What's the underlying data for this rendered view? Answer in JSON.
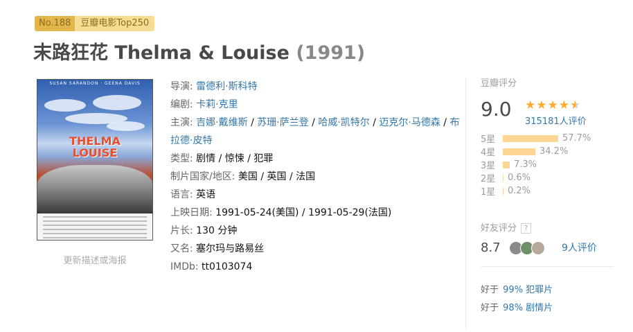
{
  "top250": {
    "rank": "No.188",
    "label": "豆瓣电影Top250"
  },
  "movie": {
    "title": "末路狂花 Thelma & Louise",
    "year": "(1991)"
  },
  "poster": {
    "cast_line": "SUSAN SARANDON · GEENA DAVIS",
    "title_line1": "THELMA",
    "title_line2": "LOUISE",
    "update_link": "更新描述或海报"
  },
  "info": {
    "director_label": "导演:",
    "director": "雷德利·斯科特",
    "writer_label": "编剧:",
    "writer": "卡莉·克里",
    "cast_label": "主演:",
    "cast": [
      "吉娜·戴维斯",
      "苏珊·萨兰登",
      "哈威·凯特尔",
      "迈克尔·马德森",
      "布拉德·皮特"
    ],
    "genre_label": "类型:",
    "genres": [
      "剧情",
      "惊悚",
      "犯罪"
    ],
    "country_label": "制片国家/地区:",
    "country": "美国 / 英国 / 法国",
    "language_label": "语言:",
    "language": "英语",
    "release_label": "上映日期:",
    "release_dates": [
      "1991-05-24(美国)",
      "1991-05-29(法国)"
    ],
    "runtime_label": "片长:",
    "runtime": "130 分钟",
    "aka_label": "又名:",
    "aka": "塞尔玛与路易丝",
    "imdb_label": "IMDb:",
    "imdb": "tt0103074"
  },
  "rating": {
    "title": "豆瓣评分",
    "score": "9.0",
    "stars_value": 4.5,
    "votes": "315181人评价",
    "distribution": [
      {
        "label": "5星",
        "percent": "57.7%",
        "value": 57.7
      },
      {
        "label": "4星",
        "percent": "34.2%",
        "value": 34.2
      },
      {
        "label": "3星",
        "percent": "7.3%",
        "value": 7.3
      },
      {
        "label": "2星",
        "percent": "0.6%",
        "value": 0.6
      },
      {
        "label": "1星",
        "percent": "0.2%",
        "value": 0.2
      }
    ]
  },
  "friends": {
    "title": "好友评分",
    "help": "?",
    "score": "8.7",
    "count": "9人评价"
  },
  "better_than": [
    {
      "prefix": "好于",
      "value": "99% 犯罪片"
    },
    {
      "prefix": "好于",
      "value": "98% 剧情片"
    }
  ],
  "colors": {
    "link": "#3377aa",
    "star": "#ffac2d",
    "bar": "#ffd596",
    "badge": "#e3b64b"
  }
}
